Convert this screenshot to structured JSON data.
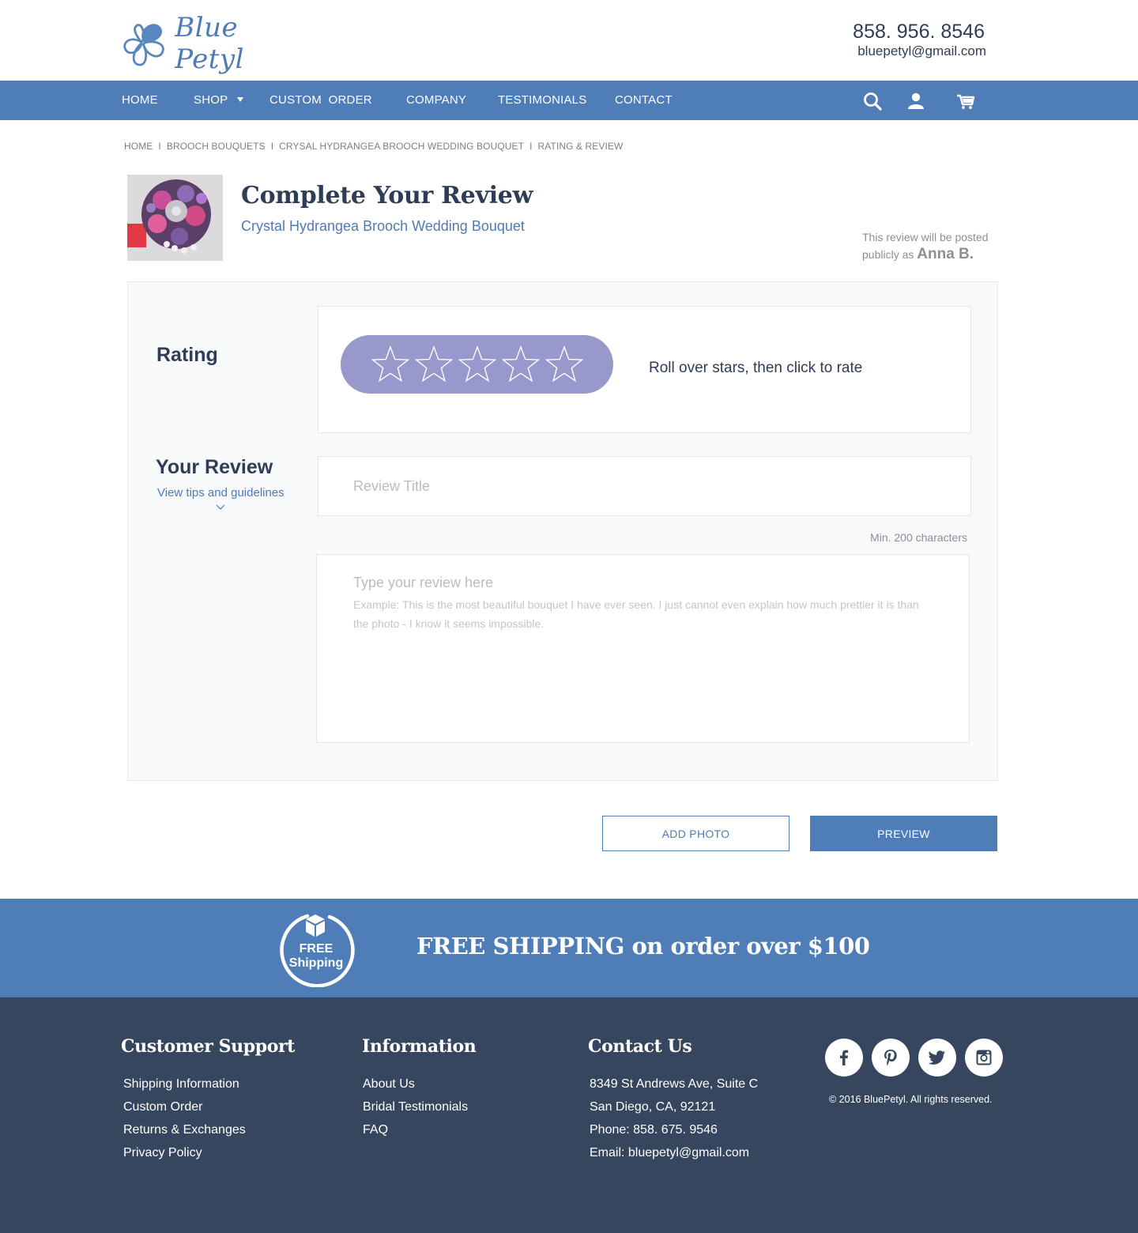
{
  "brand": {
    "name": "Blue Petyl",
    "phone": "858. 956. 8546",
    "email": "bluepetyl@gmail.com"
  },
  "nav": {
    "items": [
      {
        "label": "HOME"
      },
      {
        "label": "SHOP"
      },
      {
        "label": "CUSTOM  ORDER"
      },
      {
        "label": "COMPANY"
      },
      {
        "label": "TESTIMONIALS"
      },
      {
        "label": "CONTACT"
      }
    ],
    "icons": [
      "search-icon",
      "user-icon",
      "cart-icon"
    ]
  },
  "breadcrumb": {
    "items": [
      "HOME",
      "BROOCH BOUQUETS",
      "CRYSAL HYDRANGEA BROOCH WEDDING BOUQUET",
      "RATING & REVIEW"
    ],
    "separator": "I"
  },
  "review": {
    "title": "Complete Your Review",
    "product_name": "Crystal Hydrangea Brooch Wedding Bouquet",
    "posted_prefix": "This review will be posted",
    "posted_as_label": "publicly as",
    "posted_as_name": "Anna B."
  },
  "rating": {
    "label": "Rating",
    "stars_total": 5,
    "stars_selected": 0,
    "hint": "Roll over stars, then click to rate",
    "pill_color": "#9898cc"
  },
  "your_review": {
    "label": "Your Review",
    "tips_link": "View tips and guidelines",
    "title_placeholder": "Review Title",
    "min_chars": "Min. 200 characters",
    "body_placeholder": "Type your review here",
    "body_example": "Example: This is the most beautiful bouquet I have ever seen. I just cannot even explain how much prettier it is than the photo - I know it seems impossible."
  },
  "buttons": {
    "add_photo": "ADD PHOTO",
    "preview": "PREVIEW"
  },
  "shipping": {
    "badge_line1": "FREE",
    "badge_line2": "Shipping",
    "text": "FREE SHIPPING on order over $100"
  },
  "footer": {
    "customer_support": {
      "heading": "Customer Support",
      "links": [
        "Shipping Information",
        "Custom Order",
        "Returns & Exchanges",
        "Privacy Policy"
      ]
    },
    "information": {
      "heading": "Information",
      "links": [
        "About Us",
        "Bridal Testimonials",
        "FAQ"
      ]
    },
    "contact": {
      "heading": "Contact Us",
      "lines": [
        "8349 St Andrews Ave, Suite C",
        "San Diego, CA, 92121",
        "Phone: 858. 675. 9546",
        "Email: bluepetyl@gmail.com"
      ]
    },
    "social": [
      "facebook-icon",
      "pinterest-icon",
      "twitter-icon",
      "instagram-icon"
    ],
    "copyright": "© 2016 BluePetyl. All rights reserved."
  },
  "colors": {
    "brand_blue": "#4e7db8",
    "link_blue": "#4e7bb6",
    "dark_navy": "#2e3d55",
    "footer_bg": "#36465e",
    "panel_bg": "#f7f9fa"
  }
}
